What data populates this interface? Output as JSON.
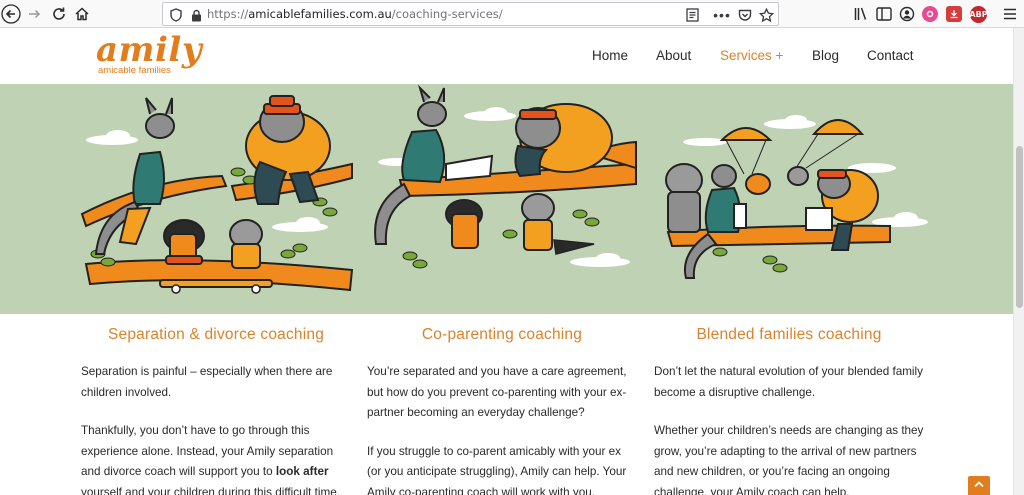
{
  "browser": {
    "url_prefix": "https://",
    "url_host": "amicablefamilies.com.au",
    "url_path": "/coaching-services/",
    "icons": [
      "back-icon",
      "forward-icon",
      "reload-icon",
      "home-icon",
      "shield-icon",
      "lock-icon",
      "reader-view-icon",
      "more-icon",
      "pocket-icon",
      "bookmark-star-icon",
      "library-icon",
      "sidebar-icon",
      "account-icon",
      "extension-icon",
      "extension-icon",
      "adblock-icon",
      "menu-icon"
    ],
    "adblock_label": "ABP"
  },
  "site": {
    "logo_word": "amily",
    "logo_tagline": "amicable families",
    "brand_color": "#e27d1e",
    "nav": [
      {
        "label": "Home"
      },
      {
        "label": "About"
      },
      {
        "label": "Services +"
      },
      {
        "label": "Blog"
      },
      {
        "label": "Contact"
      }
    ]
  },
  "hero": {
    "background": "#bfd2b4"
  },
  "columns": [
    {
      "title": "Separation & divorce coaching",
      "p1": "Separation is painful – especially when there are children involved.",
      "p2_start": "Thankfully, you don’t have to go through this experience alone. Instead, your Amily separation and divorce coach will support you to ",
      "p2_bold": "look after",
      "p2_end": " yourself and your children during this difficult time."
    },
    {
      "title": "Co-parenting coaching",
      "p1": "You’re separated and you have a care agreement, but how do you prevent co-parenting with your ex-partner becoming an everyday challenge?",
      "p2": "If you struggle to co-parent amicably with your ex (or you anticipate struggling), Amily can help. Your Amily co-parenting coach will work with you."
    },
    {
      "title": "Blended families coaching",
      "p1": "Don’t let the natural evolution of your blended family become a disruptive challenge.",
      "p2": "Whether your children’s needs are changing as they grow, you’re adapting to the arrival of new partners and new children, or you’re facing an ongoing challenge, your Amily coach can help."
    }
  ]
}
